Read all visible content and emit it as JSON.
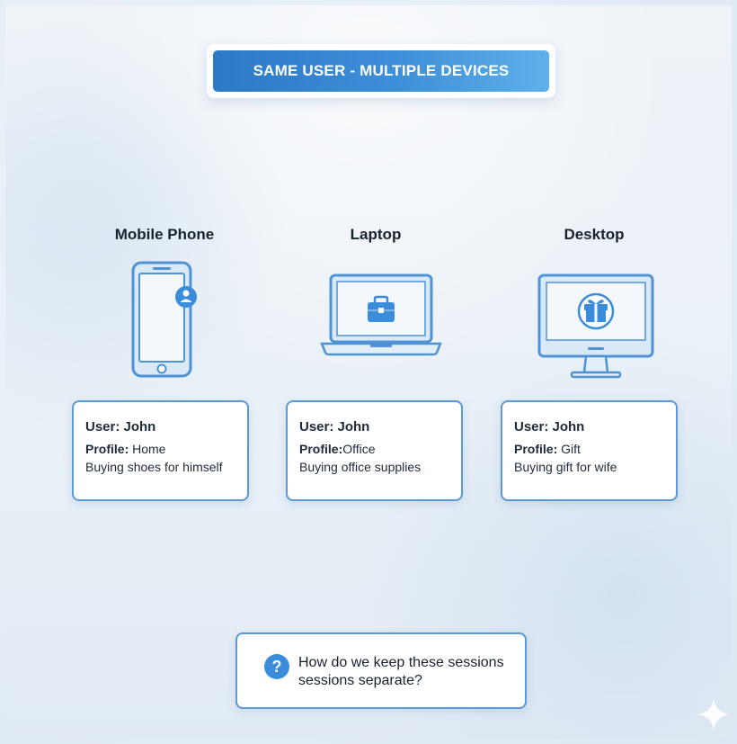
{
  "header": {
    "title": "SAME USER - MULTIPLE DEVICES"
  },
  "devices": [
    {
      "title": "Mobile Phone",
      "icon": "mobile-phone-icon",
      "user": "User: John",
      "profile_label": "Profile:",
      "profile_value": " Home",
      "activity": "Buying shoes for himself"
    },
    {
      "title": "Laptop",
      "icon": "laptop-icon",
      "user": "User: John",
      "profile_label": "Profile:",
      "profile_value": "Office",
      "activity": "Buying office supplies"
    },
    {
      "title": "Desktop",
      "icon": "desktop-icon",
      "user": "User: John",
      "profile_label": "Profile:",
      "profile_value": " Gift",
      "activity": "Buying gift for wife"
    }
  ],
  "question": {
    "icon": "question-icon",
    "text": "How do we keep these sessions sessions separate?"
  },
  "colors": {
    "accent": "#3b8ddb",
    "title_gradient_start": "#2d78c4",
    "title_gradient_end": "#5fb0ea",
    "card_border": "#5a9ad6"
  }
}
